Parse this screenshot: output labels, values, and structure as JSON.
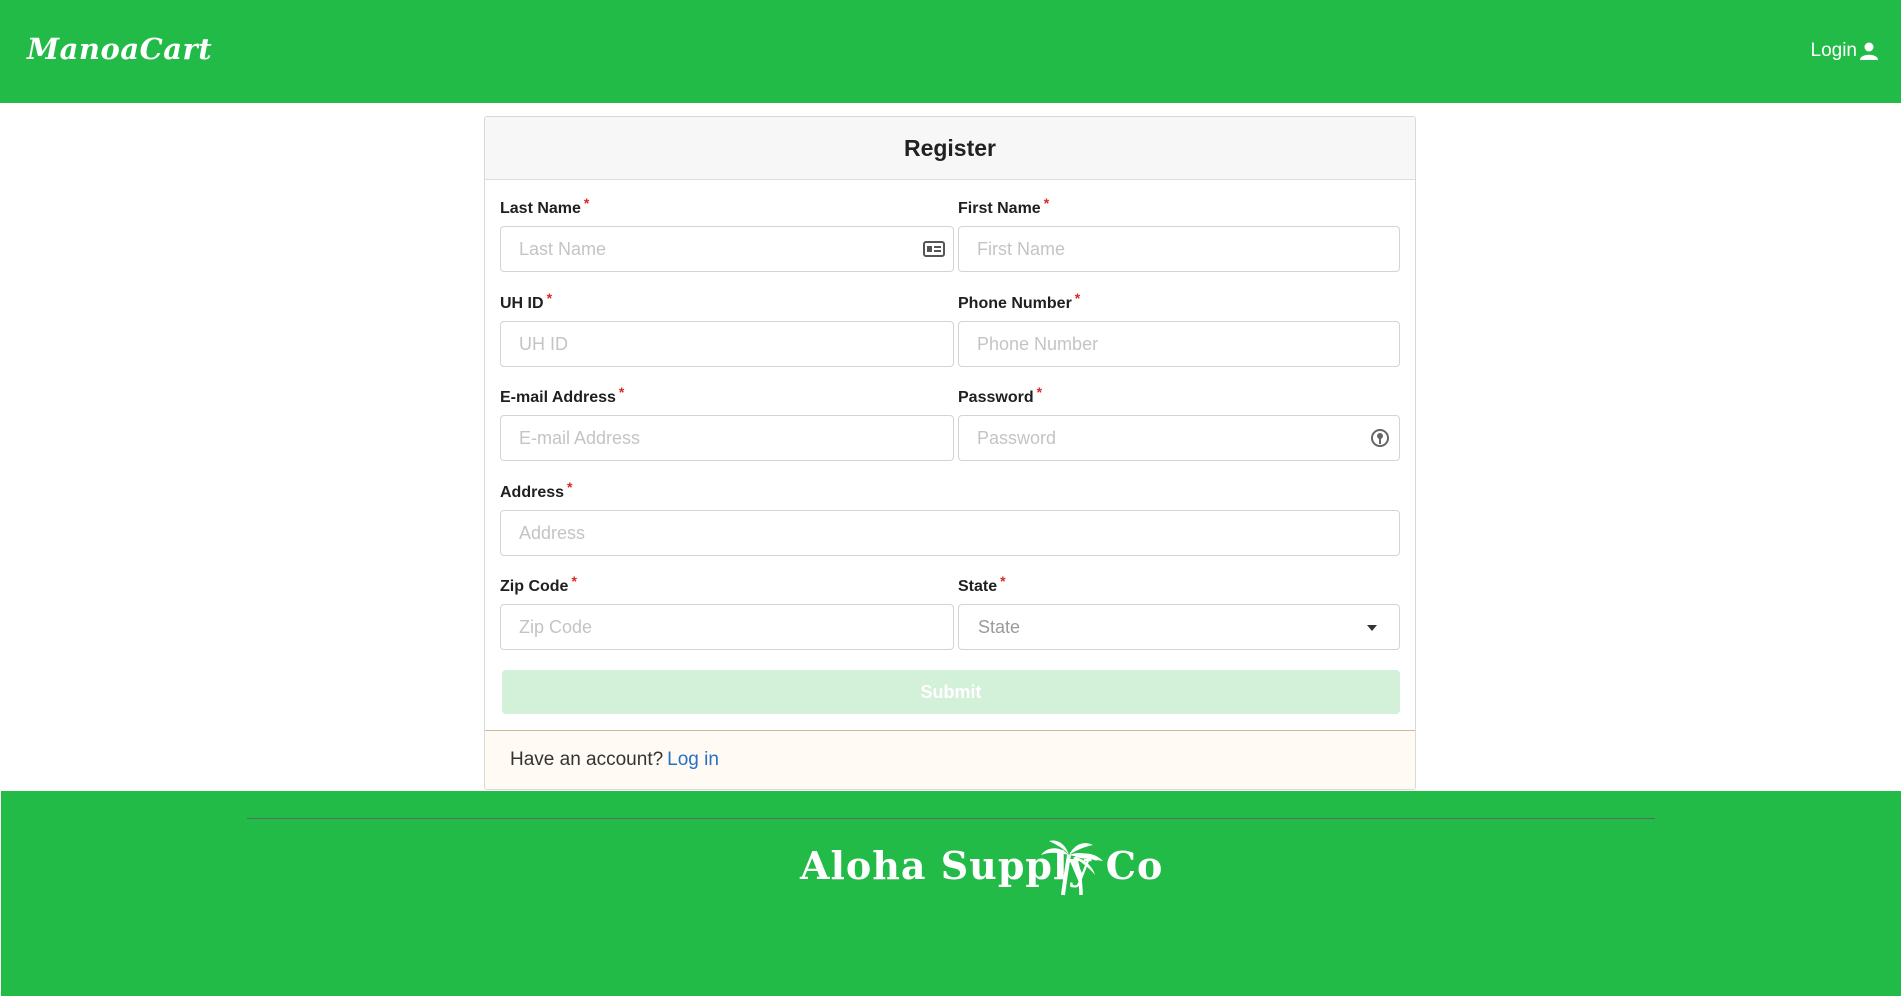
{
  "header": {
    "brand": "ManoaCart",
    "login_label": "Login",
    "login_icon": "user-icon"
  },
  "form": {
    "title": "Register",
    "fields": {
      "last_name": {
        "label": "Last Name",
        "placeholder": "Last Name",
        "icon": "id-card-icon"
      },
      "first_name": {
        "label": "First Name",
        "placeholder": "First Name"
      },
      "uh_id": {
        "label": "UH ID",
        "placeholder": "UH ID"
      },
      "phone": {
        "label": "Phone Number",
        "placeholder": "Phone Number"
      },
      "email": {
        "label": "E-mail Address",
        "placeholder": "E-mail Address"
      },
      "password": {
        "label": "Password",
        "placeholder": "Password",
        "icon": "password-key-icon"
      },
      "address": {
        "label": "Address",
        "placeholder": "Address"
      },
      "zip": {
        "label": "Zip Code",
        "placeholder": "Zip Code"
      },
      "state": {
        "label": "State",
        "placeholder": "State"
      }
    },
    "required_marker": "*",
    "submit_label": "Submit",
    "footer_text": "Have an account?",
    "footer_link": "Log in"
  },
  "footer": {
    "logo_text": "Aloha Supply Co",
    "logo_icon": "palm-tree-icon"
  },
  "colors": {
    "brand_green": "#22bb48",
    "submit_disabled": "#d3f0d9",
    "link_blue": "#2671c4",
    "required_red": "#db2828"
  }
}
